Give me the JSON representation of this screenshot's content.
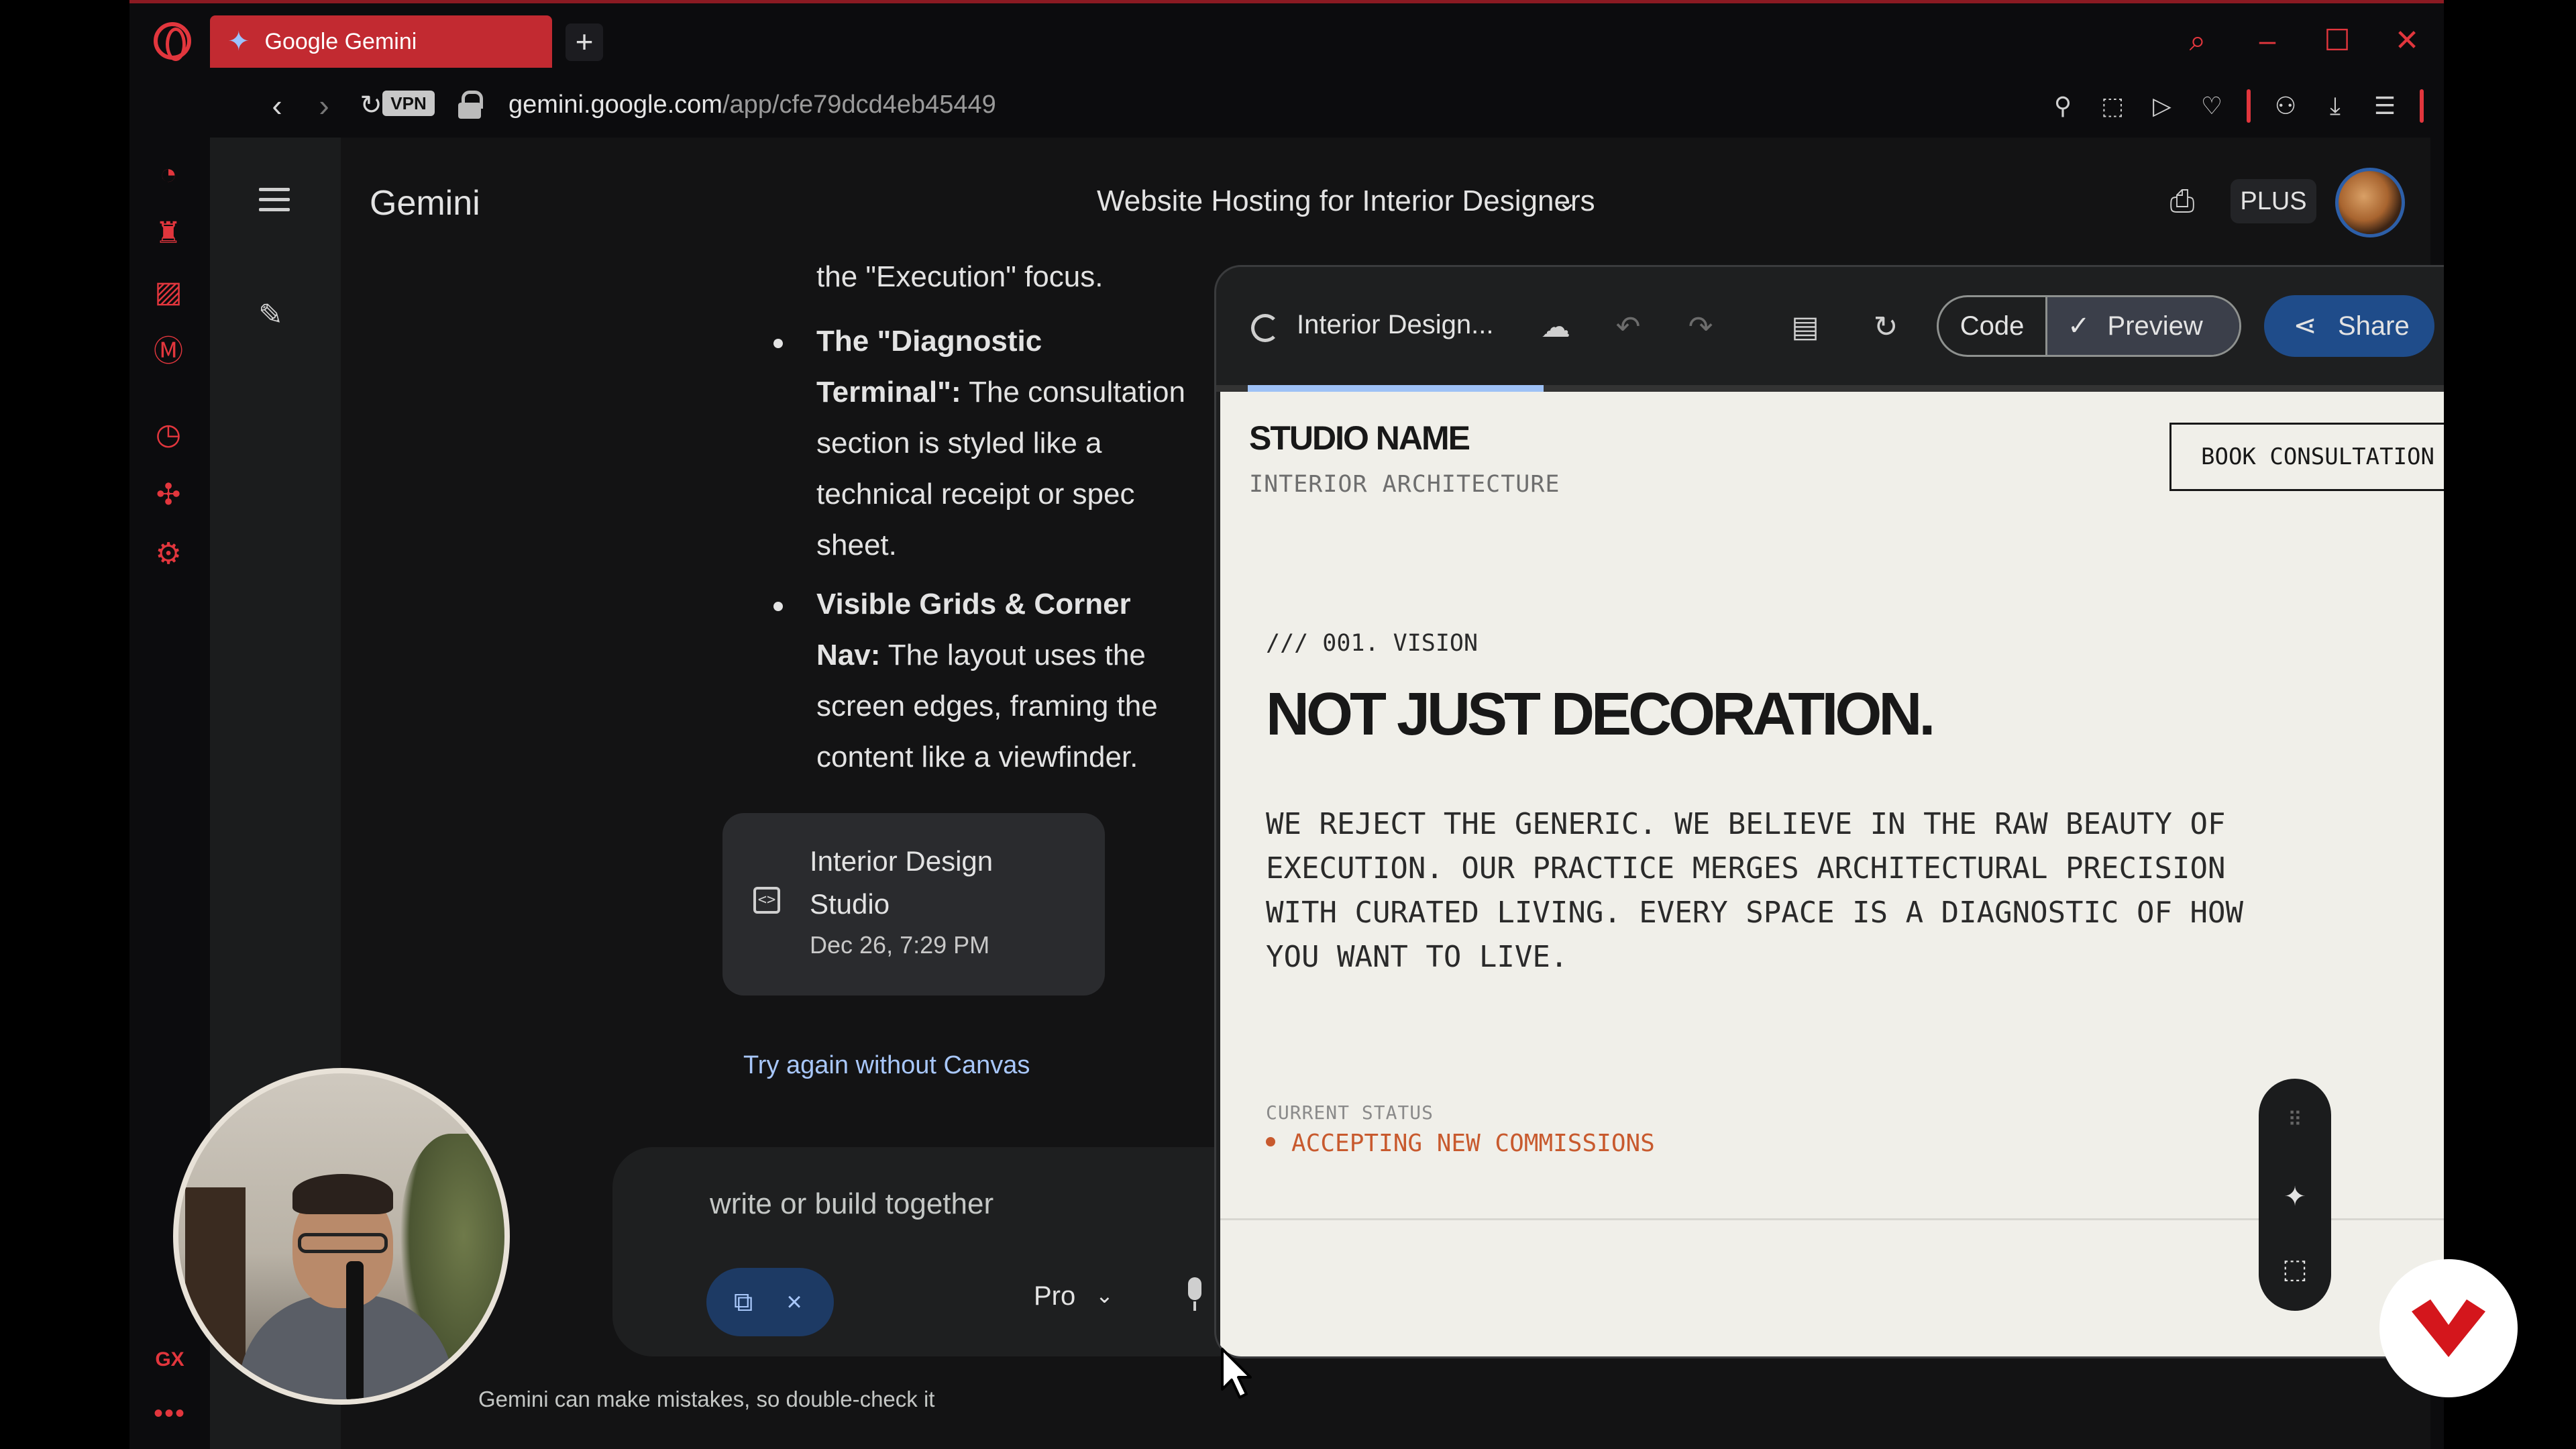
{
  "browser": {
    "tab_title": "Google Gemini",
    "new_tab": "+",
    "vpn_badge": "VPN",
    "url_domain": "gemini.google.com",
    "url_path": "/app/cfe79dcd4eb45449"
  },
  "gemini": {
    "brand": "Gemini",
    "conversation_title": "Website Hosting for Interior Designers",
    "plan_badge": "PLUS"
  },
  "chat": {
    "line_intro": "the \"Execution\" focus.",
    "bullets": [
      {
        "title_line1": "The \"Diagnostic",
        "title_line2": "Terminal\":",
        "rest_line2": " The consultation",
        "line3": "section is styled like a",
        "line4": "technical receipt or spec",
        "line5": "sheet."
      },
      {
        "title_line1": "Visible Grids & Corner",
        "title_line2": "Nav:",
        "rest_line2": " The layout uses the",
        "line3": "screen edges, framing the",
        "line4": "content like a viewfinder."
      }
    ],
    "artifact": {
      "title_line1": "Interior Design",
      "title_line2": "Studio",
      "date": "Dec 26, 7:29 PM"
    },
    "try_again": "Try again without Canvas",
    "composer_placeholder": "write or build together",
    "model": "Pro",
    "disclaimer": "Gemini can make mistakes, so double-check it"
  },
  "canvas": {
    "title": "Interior Design...",
    "code_label": "Code",
    "preview_label": "Preview",
    "share_label": "Share",
    "load_progress_start": 0.024,
    "load_progress_end": 0.25
  },
  "site": {
    "studio_name": "STUDIO NAME",
    "studio_sub": "INTERIOR ARCHITECTURE",
    "book_button": "BOOK CONSULTATION",
    "vision_label": "/// 001. VISION",
    "vision_heading": "NOT JUST DECORATION.",
    "vision_line1": "WE REJECT THE GENERIC. WE BELIEVE IN THE RAW BEAUTY OF",
    "vision_line2": "EXECUTION. OUR PRACTICE MERGES ARCHITECTURAL PRECISION",
    "vision_line3": "WITH CURATED LIVING. EVERY SPACE IS A DIAGNOSTIC OF HOW",
    "vision_line4": "YOU WANT TO LIVE.",
    "status_label": "CURRENT STATUS",
    "status_value": "ACCEPTING NEW COMMISSIONS"
  },
  "opera": {
    "gx_label": "GX",
    "more": "•••"
  },
  "colors": {
    "opera_accent": "#e2363d",
    "tab_active": "#c22a31",
    "site_background": "#f0efe9",
    "status_orange": "#c85a2e",
    "link_blue": "#a8c7fa",
    "share_button": "#1f4c8a"
  }
}
